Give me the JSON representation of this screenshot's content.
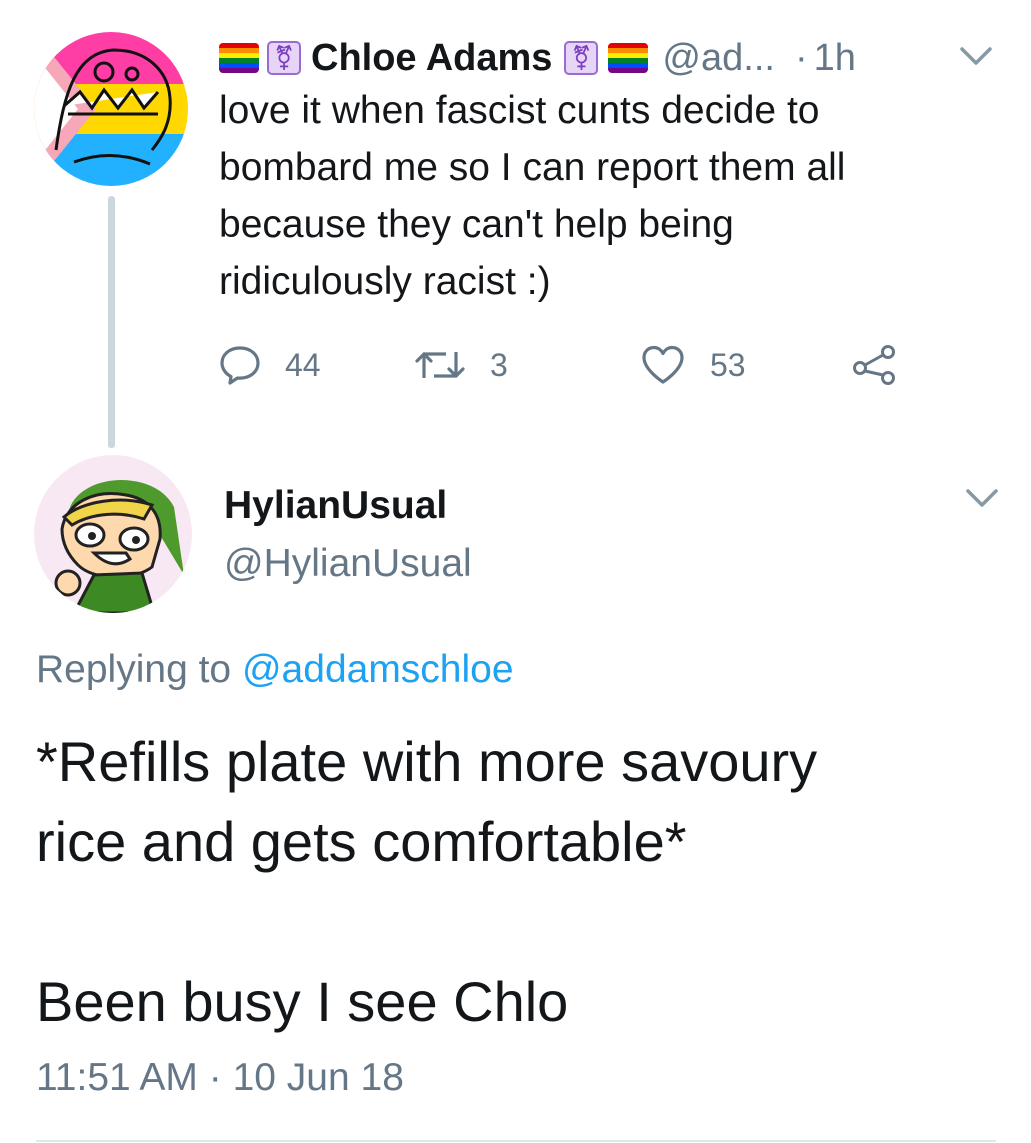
{
  "parent_tweet": {
    "author_name": "Chloe Adams",
    "handle": "@ad...",
    "separator": "·",
    "time_ago": "1h",
    "text": "love it when fascist cunts decide to\nbombard me so I can report them all\nbecause they can't help being\nridiculously racist :)",
    "reply_count": "44",
    "retweet_count": "3",
    "like_count": "53",
    "name_icons": [
      "rainbow-flag-icon",
      "transgender-symbol-icon"
    ],
    "icons": {
      "reply": "reply-icon",
      "retweet": "retweet-icon",
      "like": "heart-icon",
      "share": "share-icon",
      "menu": "chevron-down-icon"
    }
  },
  "reply_tweet": {
    "author_name": "HylianUsual",
    "handle": "@HylianUsual",
    "replying_prefix": "Replying to",
    "replying_to": "@addamschloe",
    "text": "*Refills plate with more savoury\nrice and gets comfortable*\n\nBeen busy I see Chlo",
    "time": "11:51 AM",
    "separator": "·",
    "date": "10 Jun 18"
  },
  "colors": {
    "text": "#14171a",
    "secondary": "#657786",
    "link": "#1da1f2",
    "thread_line": "#ccd6dd",
    "divider": "#e1e8ed"
  }
}
